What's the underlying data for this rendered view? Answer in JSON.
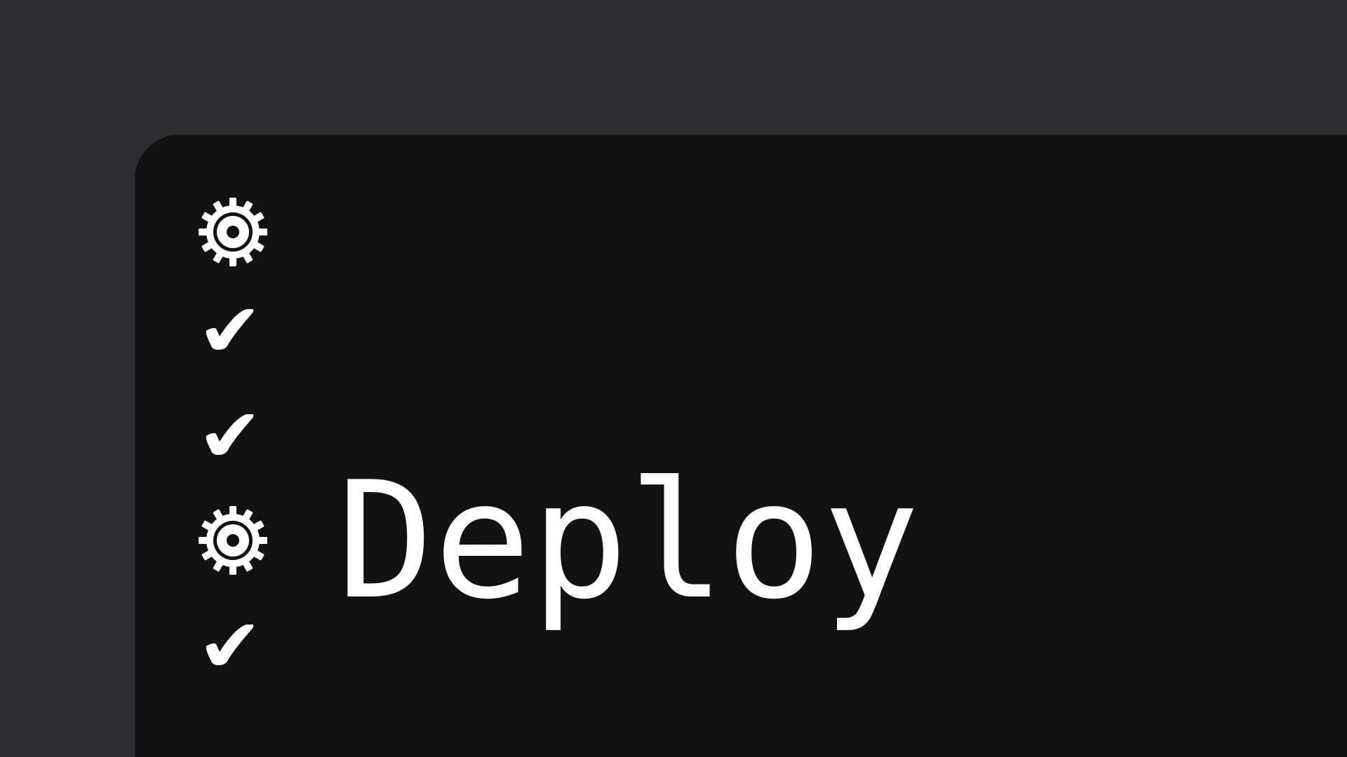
{
  "pipeline": {
    "steps": [
      {
        "status_icon": "gear-icon",
        "label": ""
      },
      {
        "status_icon": "check-icon",
        "label": ""
      },
      {
        "status_icon": "check-icon",
        "label": ""
      },
      {
        "status_icon": "gear-icon",
        "label": "Deploy"
      },
      {
        "status_icon": "check-icon",
        "label": ""
      }
    ]
  },
  "colors": {
    "background": "#2d2e32",
    "panel": "#121212",
    "foreground": "#ffffff"
  }
}
